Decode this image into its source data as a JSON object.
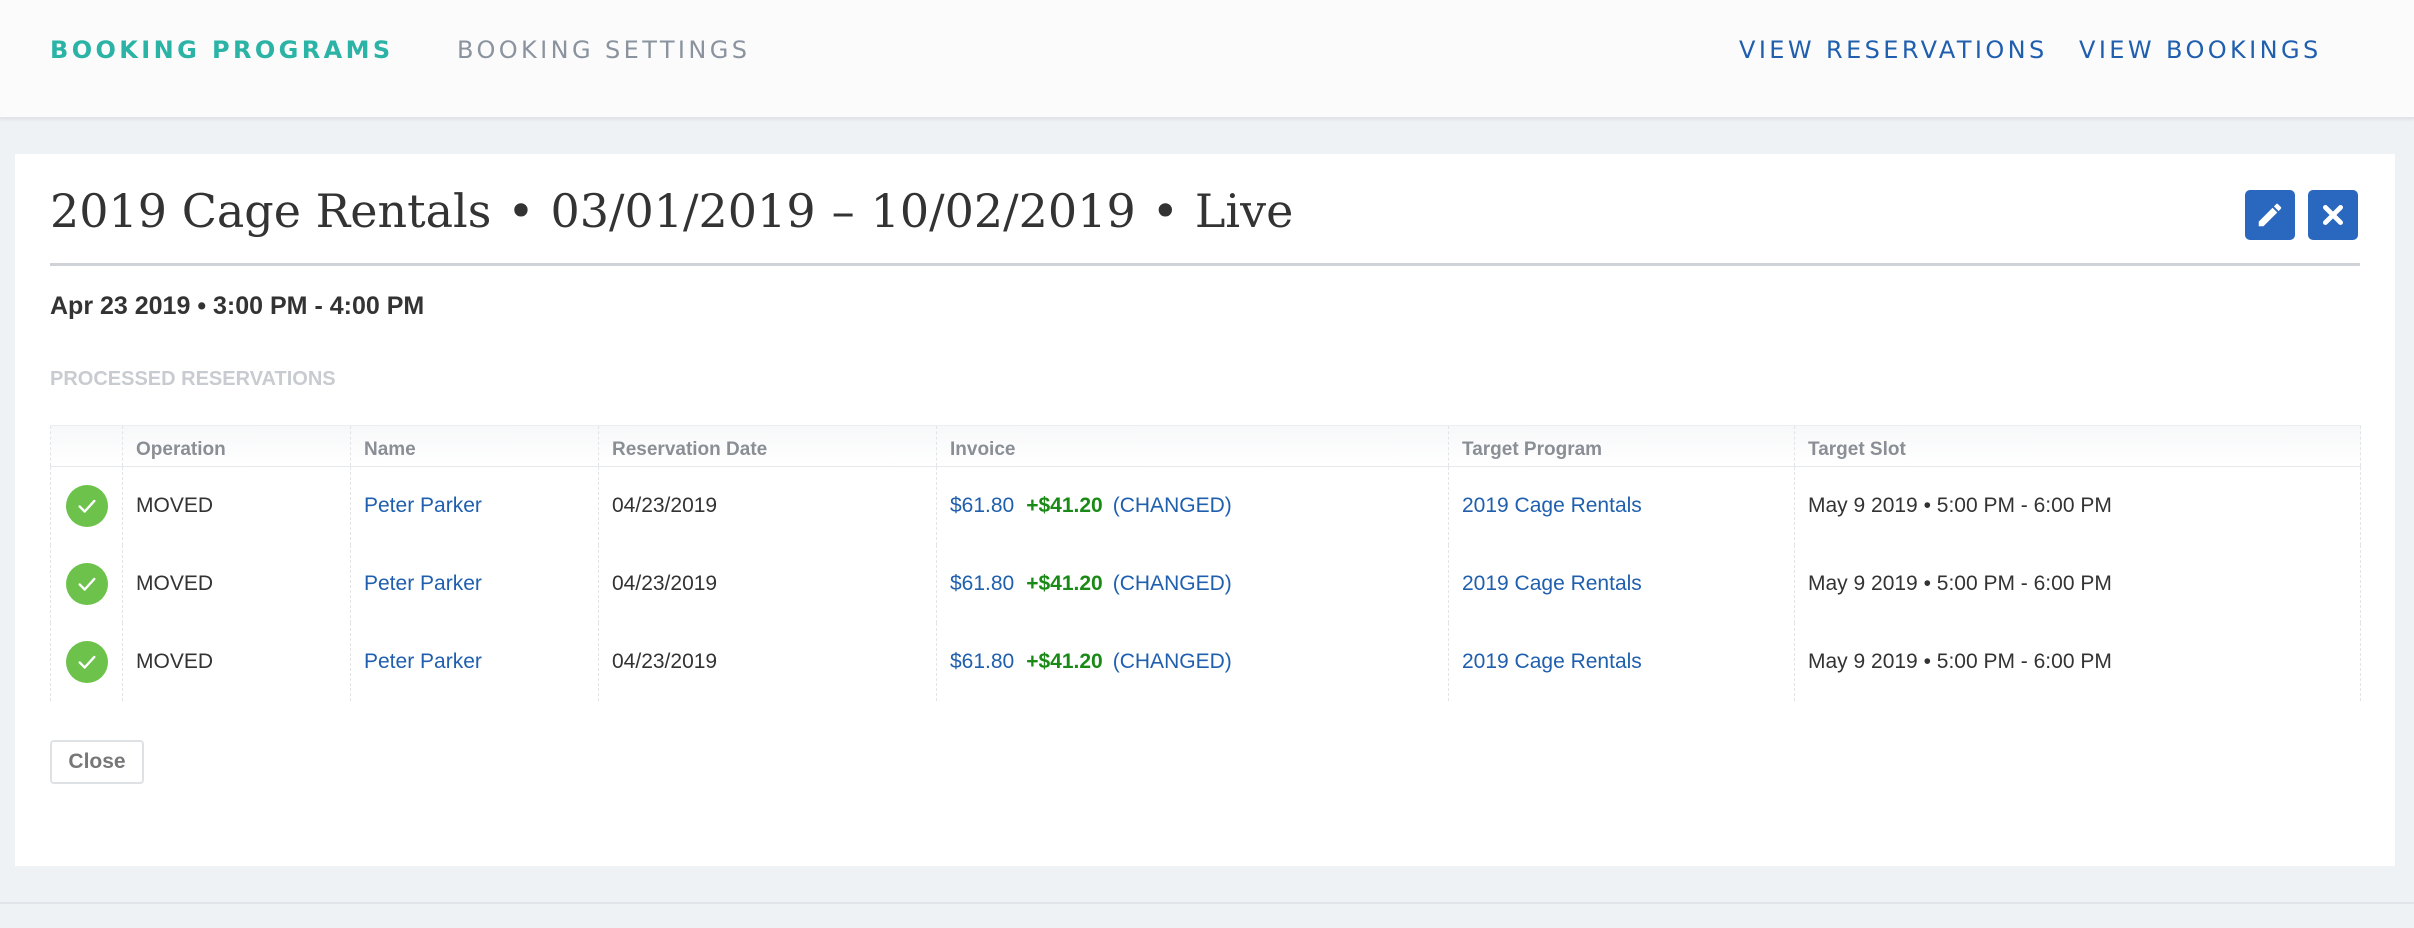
{
  "nav": {
    "booking_programs": "BOOKING PROGRAMS",
    "booking_settings": "BOOKING SETTINGS",
    "view_reservations": "VIEW RESERVATIONS",
    "view_bookings": "VIEW BOOKINGS"
  },
  "header": {
    "program": "2019 Cage Rentals",
    "bullet": "•",
    "start_date": "03/01/2019",
    "dash": "–",
    "end_date": "10/02/2019",
    "status": "Live"
  },
  "icons": {
    "edit": "pencil-icon",
    "close": "x-icon"
  },
  "colors": {
    "accent": "#2bb3a6",
    "link": "#1f5fae",
    "button": "#2a67bf",
    "success": "#6cc24a",
    "added": "#1a8a16"
  },
  "slot": "Apr 23 2019 • 3:00 PM - 4:00 PM",
  "section_label": "PROCESSED RESERVATIONS",
  "table": {
    "columns": [
      "",
      "Operation",
      "Name",
      "Reservation Date",
      "Invoice",
      "Target Program",
      "Target Slot"
    ],
    "rows": [
      {
        "operation": "MOVED",
        "name": "Peter Parker",
        "date": "04/23/2019",
        "invoice": "$61.80",
        "added": "+$41.20",
        "changed": "(CHANGED)",
        "target_program": "2019 Cage Rentals",
        "target_slot": "May 9 2019 • 5:00 PM - 6:00 PM"
      },
      {
        "operation": "MOVED",
        "name": "Peter Parker",
        "date": "04/23/2019",
        "invoice": "$61.80",
        "added": "+$41.20",
        "changed": "(CHANGED)",
        "target_program": "2019 Cage Rentals",
        "target_slot": "May 9 2019 • 5:00 PM - 6:00 PM"
      },
      {
        "operation": "MOVED",
        "name": "Peter Parker",
        "date": "04/23/2019",
        "invoice": "$61.80",
        "added": "+$41.20",
        "changed": "(CHANGED)",
        "target_program": "2019 Cage Rentals",
        "target_slot": "May 9 2019 • 5:00 PM - 6:00 PM"
      }
    ]
  },
  "close_label": "Close"
}
